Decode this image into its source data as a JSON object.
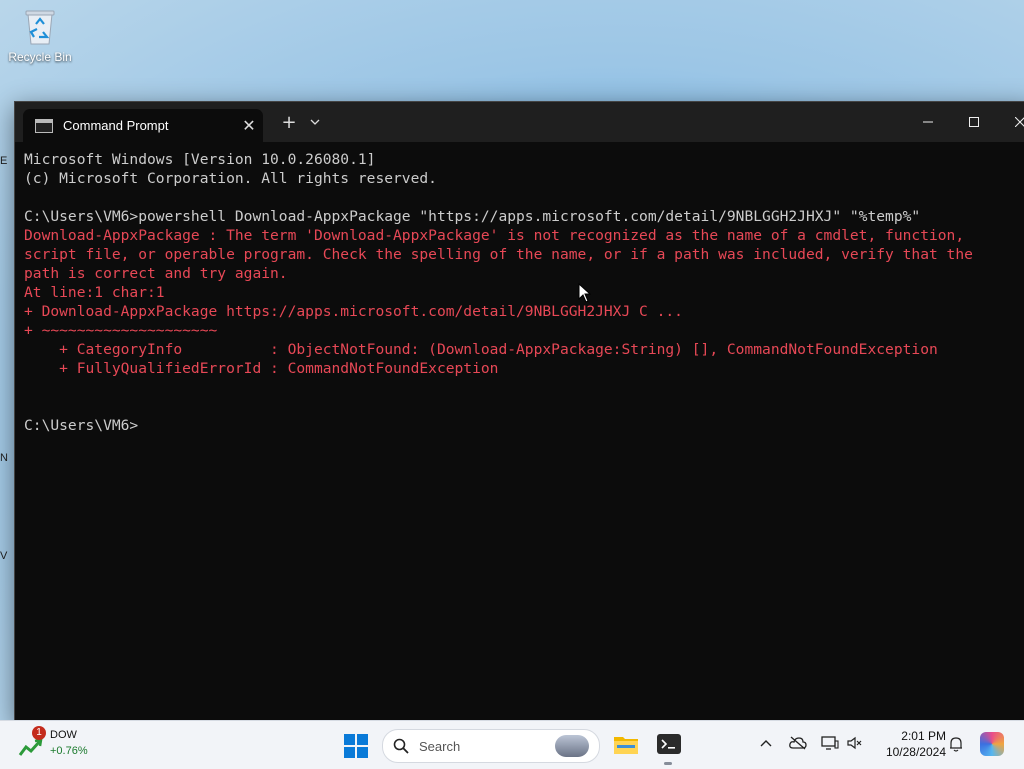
{
  "desktop": {
    "recycle_bin_label": "Recycle Bin"
  },
  "window": {
    "tab_title": "Command Prompt",
    "new_tab_label": "+",
    "dropdown_label": "⌄",
    "close_tab_label": "✕",
    "minimize_label": "—",
    "maximize_label": "☐",
    "close_label": "✕"
  },
  "console": {
    "lines": [
      {
        "text": "Microsoft Windows [Version 10.0.26080.1]",
        "type": "normal"
      },
      {
        "text": "(c) Microsoft Corporation. All rights reserved.",
        "type": "normal"
      },
      {
        "text": "",
        "type": "normal"
      },
      {
        "text": "C:\\Users\\VM6>powershell Download-AppxPackage \"https://apps.microsoft.com/detail/9NBLGGH2JHXJ\" \"%temp%\"",
        "type": "normal"
      },
      {
        "text": "Download-AppxPackage : The term 'Download-AppxPackage' is not recognized as the name of a cmdlet, function,",
        "type": "error"
      },
      {
        "text": "script file, or operable program. Check the spelling of the name, or if a path was included, verify that the",
        "type": "error"
      },
      {
        "text": "path is correct and try again.",
        "type": "error"
      },
      {
        "text": "At line:1 char:1",
        "type": "error"
      },
      {
        "text": "+ Download-AppxPackage https://apps.microsoft.com/detail/9NBLGGH2JHXJ C ...",
        "type": "error"
      },
      {
        "text": "+ ~~~~~~~~~~~~~~~~~~~~",
        "type": "error"
      },
      {
        "text": "    + CategoryInfo          : ObjectNotFound: (Download-AppxPackage:String) [], CommandNotFoundException",
        "type": "error"
      },
      {
        "text": "    + FullyQualifiedErrorId : CommandNotFoundException",
        "type": "error"
      },
      {
        "text": "",
        "type": "normal"
      },
      {
        "text": "",
        "type": "normal"
      },
      {
        "text": "C:\\Users\\VM6>",
        "type": "normal"
      }
    ]
  },
  "taskbar": {
    "widget": {
      "badge": "1",
      "ticker": "DOW",
      "change": "+0.76%"
    },
    "search_placeholder": "Search",
    "tray": {
      "overflow_label": "^"
    },
    "clock": {
      "time": "2:01 PM",
      "date": "10/28/2024"
    }
  },
  "colors": {
    "error_text": "#e74856",
    "console_text": "#cccccc",
    "console_bg": "#0c0c0c"
  }
}
